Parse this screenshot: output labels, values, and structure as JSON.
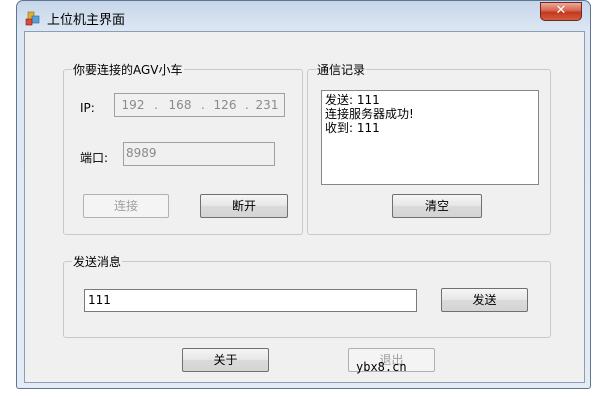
{
  "window": {
    "title": "上位机主界面",
    "close_glyph": "✕"
  },
  "agv_group": {
    "label": "你要连接的AGV小车",
    "ip_label": "IP:",
    "ip": [
      "192",
      "168",
      "126",
      "231"
    ],
    "ip_sep": ".",
    "port_label": "端口:",
    "port_value": "8989",
    "connect_label": "连接",
    "disconnect_label": "断开"
  },
  "comm_group": {
    "label": "通信记录",
    "log": [
      "发送: 111",
      "连接服务器成功!",
      "收到: 111"
    ],
    "clear_label": "清空"
  },
  "send_group": {
    "label": "发送消息",
    "message_value": "111",
    "send_label": "发送"
  },
  "footer": {
    "about_label": "关于",
    "exit_label": "退出"
  },
  "watermark": "ybx8.cn",
  "colors": {
    "close_button": "#c1391f",
    "title_bar": "#c6d6ea",
    "client_bg": "#f0f0f0"
  }
}
